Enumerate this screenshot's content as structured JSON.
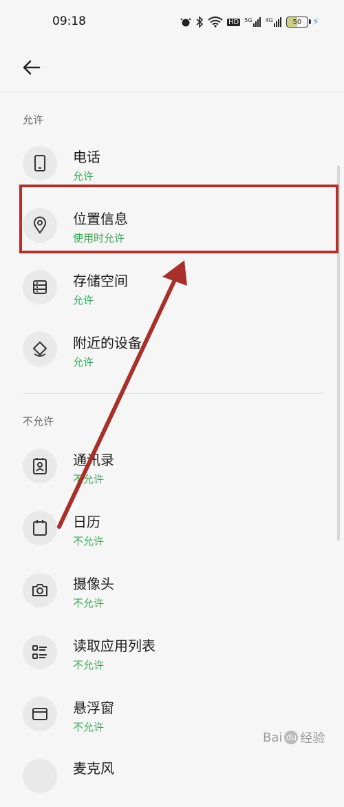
{
  "status_bar": {
    "time": "09:18",
    "battery": "50",
    "network_labels": [
      "HD",
      "5G",
      "4G"
    ]
  },
  "sections": {
    "allowed_title": "允许",
    "denied_title": "不允许"
  },
  "allowed": [
    {
      "name": "电话",
      "status": "允许",
      "icon": "phone-icon"
    },
    {
      "name": "位置信息",
      "status": "使用时允许",
      "icon": "location-icon"
    },
    {
      "name": "存储空间",
      "status": "允许",
      "icon": "storage-icon"
    },
    {
      "name": "附近的设备",
      "status": "允许",
      "icon": "nearby-devices-icon"
    }
  ],
  "denied": [
    {
      "name": "通讯录",
      "status": "不允许",
      "icon": "contacts-icon"
    },
    {
      "name": "日历",
      "status": "不允许",
      "icon": "calendar-icon"
    },
    {
      "name": "摄像头",
      "status": "不允许",
      "icon": "camera-icon"
    },
    {
      "name": "读取应用列表",
      "status": "不允许",
      "icon": "app-list-icon"
    },
    {
      "name": "悬浮窗",
      "status": "不允许",
      "icon": "floating-window-icon"
    },
    {
      "name": "麦克风",
      "status": "",
      "icon": "microphone-icon"
    }
  ],
  "watermark": {
    "brand": "Bai",
    "suffix": "经验"
  },
  "colors": {
    "status_green": "#3aa757",
    "highlight_red": "#b0302a",
    "background": "#f6f6f6"
  }
}
